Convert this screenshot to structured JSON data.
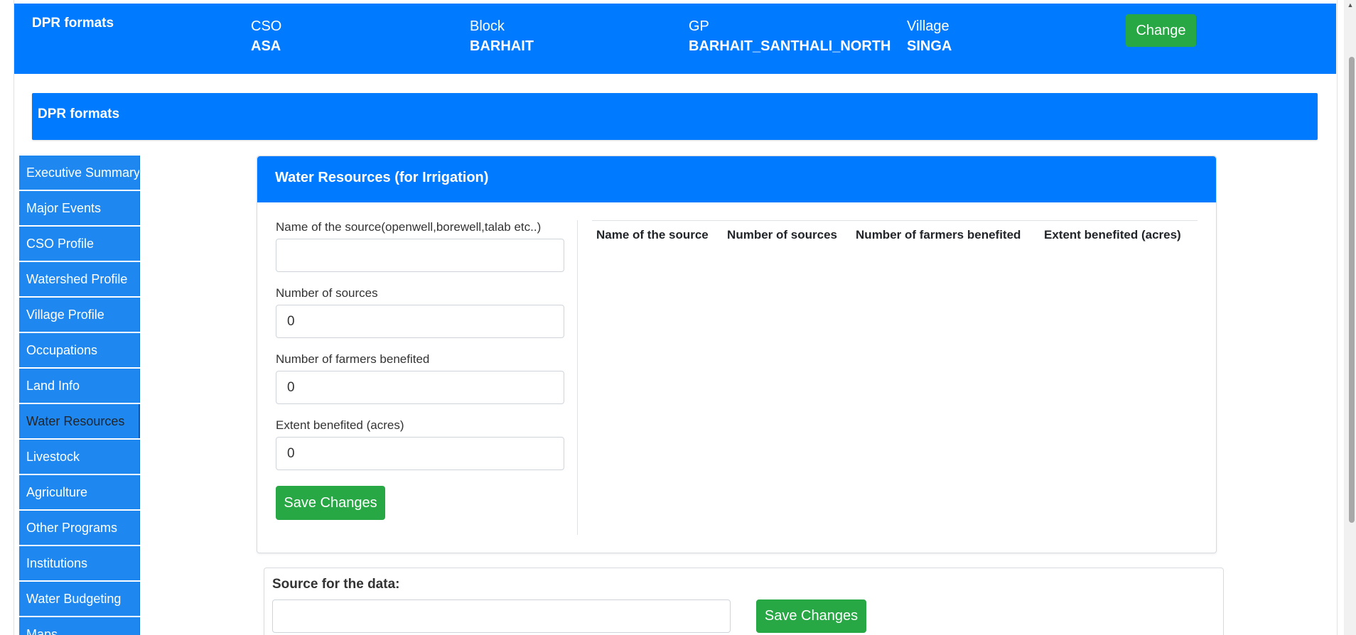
{
  "header": {
    "brand": "DPR formats",
    "fields": [
      {
        "label": "CSO",
        "value": "ASA"
      },
      {
        "label": "Block",
        "value": "BARHAIT"
      },
      {
        "label": "GP",
        "value": "BARHAIT_SANTHALI_NORTH"
      },
      {
        "label": "Village",
        "value": "SINGA"
      }
    ],
    "change_label": "Change"
  },
  "section": {
    "title": "DPR formats"
  },
  "sidebar": {
    "items": [
      {
        "label": "Executive Summary"
      },
      {
        "label": "Major Events"
      },
      {
        "label": "CSO Profile"
      },
      {
        "label": "Watershed Profile"
      },
      {
        "label": "Village Profile"
      },
      {
        "label": "Occupations"
      },
      {
        "label": "Land Info"
      },
      {
        "label": "Water Resources"
      },
      {
        "label": "Livestock"
      },
      {
        "label": "Agriculture"
      },
      {
        "label": "Other Programs"
      },
      {
        "label": "Institutions"
      },
      {
        "label": "Water Budgeting"
      },
      {
        "label": "Maps"
      }
    ],
    "active": "Water Resources"
  },
  "card": {
    "title": "Water Resources (for Irrigation)",
    "form": {
      "source_name_label": "Name of the source(openwell,borewell,talab etc..)",
      "source_name_value": "",
      "num_sources_label": "Number of sources",
      "num_sources_value": "0",
      "num_farmers_label": "Number of farmers benefited",
      "num_farmers_value": "0",
      "extent_label": "Extent benefited (acres)",
      "extent_value": "0",
      "save_label": "Save Changes"
    },
    "table": {
      "columns": [
        "Name of the source",
        "Number of sources",
        "Number of farmers benefited",
        "Extent benefited (acres)"
      ],
      "rows": []
    }
  },
  "source_section": {
    "label": "Source for the data:",
    "value": "",
    "save_label": "Save Changes"
  },
  "colors": {
    "primary": "#007bff",
    "success": "#28a745",
    "sidebar": "#1e88f0"
  }
}
